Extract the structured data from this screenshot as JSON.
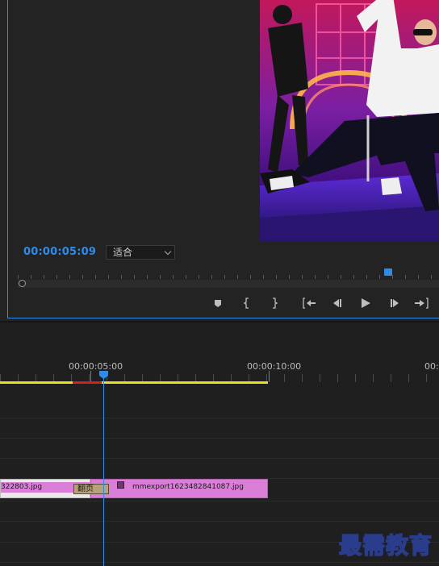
{
  "program_monitor": {
    "current_timecode": "00:00:05:09",
    "fit_select_value": "适合",
    "transport_icons": [
      "add-marker-icon",
      "mark-in-icon",
      "mark-out-icon",
      "go-to-in-icon",
      "step-back-icon",
      "play-icon",
      "step-forward-icon",
      "go-to-out-icon"
    ]
  },
  "timeline": {
    "ruler_labels": [
      "00:00:05:00",
      "00:00:10:00",
      "00:0"
    ],
    "clips": {
      "clip_a_label": "322803.jpg",
      "transition_label": "翻页",
      "clip_b_label": "mmexport1623482841087.jpg"
    }
  },
  "watermark": {
    "text": "最需教育"
  },
  "colors": {
    "accent_blue": "#2d8ceb",
    "clip_magenta": "#d97fd7",
    "work_area_yellow": "#e6e020",
    "render_red": "#d02020"
  }
}
